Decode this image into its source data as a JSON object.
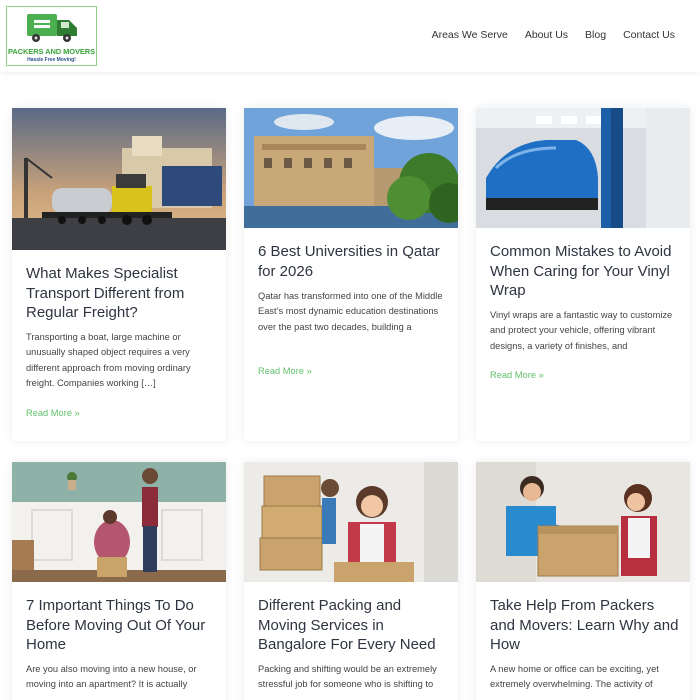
{
  "header": {
    "logo_brand": "PACKERS AND MOVERS",
    "logo_tagline": "Hassle Free Moving!",
    "nav": [
      "Areas We Serve",
      "About Us",
      "Blog",
      "Contact Us"
    ]
  },
  "colors": {
    "accent_green": "#5fbf6a",
    "logo_green": "#3aa33a",
    "title_text": "#2e3440"
  },
  "posts": [
    {
      "title": "What Makes Specialist Transport Different from Regular Freight?",
      "excerpt": "Transporting a boat, large machine or unusually shaped object requires a very different approach from moving ordinary freight. Companies working […]",
      "read_more": "Read More »"
    },
    {
      "title": "6 Best Universities in Qatar for 2026",
      "excerpt": "Qatar has transformed into one of the Middle East’s most dynamic education destinations over the past two decades, building a",
      "read_more": "Read More »"
    },
    {
      "title": "Common Mistakes to Avoid When Caring for Your Vinyl Wrap",
      "excerpt": "Vinyl wraps are a fantastic way to customize and protect your vehicle, offering vibrant designs, a variety of finishes, and",
      "read_more": "Read More »"
    },
    {
      "title": "7 Important Things To Do Before Moving Out Of Your Home",
      "excerpt": "Are you also moving into a new house, or moving into an apartment?  It is actually",
      "read_more": ""
    },
    {
      "title": "Different Packing and Moving Services in Bangalore For Every Need",
      "excerpt": "Packing and shifting would be an extremely stressful job for someone who is shifting to",
      "read_more": ""
    },
    {
      "title": "Take Help From Packers and Movers: Learn Why and How",
      "excerpt": "A new home or office can be exciting, yet extremely overwhelming. The activity of",
      "read_more": ""
    }
  ]
}
